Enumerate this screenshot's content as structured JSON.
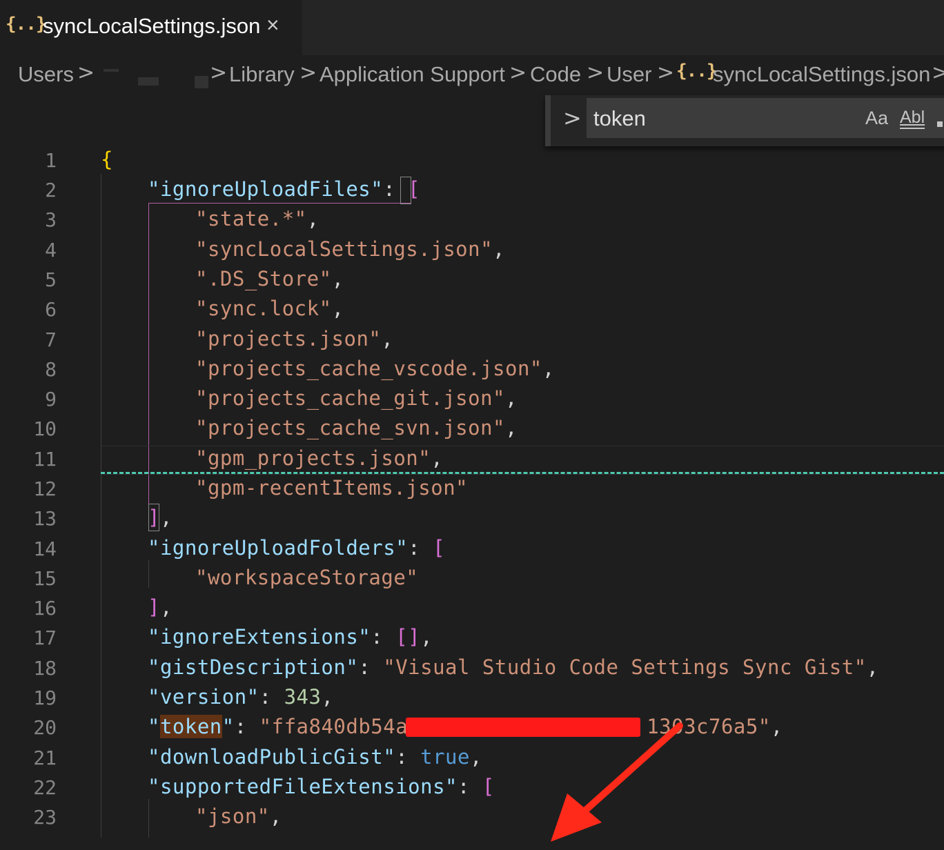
{
  "tab": {
    "icon": "{..}",
    "title": "syncLocalSettings.json",
    "close": "×"
  },
  "breadcrumb": {
    "items": [
      "Users",
      "Library",
      "Application Support",
      "Code",
      "User",
      "syncLocalSettings.json"
    ],
    "separator": ">",
    "file_icon": "{..}"
  },
  "find": {
    "toggle": ">",
    "query": "token",
    "match_case": "Aa",
    "whole_word": "Abl"
  },
  "editor": {
    "line_numbers": [
      "1",
      "2",
      "3",
      "4",
      "5",
      "6",
      "7",
      "8",
      "9",
      "10",
      "11",
      "12",
      "13",
      "14",
      "15",
      "16",
      "17",
      "18",
      "19",
      "20",
      "21",
      "22",
      "23"
    ],
    "lines": {
      "l1": "{",
      "l2_key": "\"ignoreUploadFiles\"",
      "l2_rest": ": ",
      "l2_br": "[",
      "l3": "\"state.*\"",
      "l4": "\"syncLocalSettings.json\"",
      "l5": "\".DS_Store\"",
      "l6": "\"sync.lock\"",
      "l7": "\"projects.json\"",
      "l8": "\"projects_cache_vscode.json\"",
      "l9": "\"projects_cache_git.json\"",
      "l10": "\"projects_cache_svn.json\"",
      "l11": "\"gpm_projects.json\"",
      "l12": "\"gpm-recentItems.json\"",
      "l13_br": "]",
      "l14_key": "\"ignoreUploadFolders\"",
      "l14_br": "[",
      "l15": "\"workspaceStorage\"",
      "l16_br": "]",
      "l17_key": "\"ignoreExtensions\"",
      "l17_val": "[]",
      "l18_key": "\"gistDescription\"",
      "l18_val": "\"Visual Studio Code Settings Sync Gist\"",
      "l19_key": "\"version\"",
      "l19_val": "343",
      "l20_q1": "\"",
      "l20_key": "token",
      "l20_q2": "\"",
      "l20_val_start": "\"ffa840db54a",
      "l20_val_end": "1303c76a5\"",
      "l21_key": "\"downloadPublicGist\"",
      "l21_val": "true",
      "l22_key": "\"supportedFileExtensions\"",
      "l22_br": "[",
      "l23": "\"json\""
    },
    "comma": ",",
    "colon": ": "
  },
  "colors": {
    "key": "#9cdcfe",
    "string": "#ce9178",
    "number": "#b5cea8",
    "boolean": "#569cd6",
    "brace": "#ffd700",
    "bracket": "#da70d6",
    "annotation_arrow": "#ff2a1a"
  }
}
